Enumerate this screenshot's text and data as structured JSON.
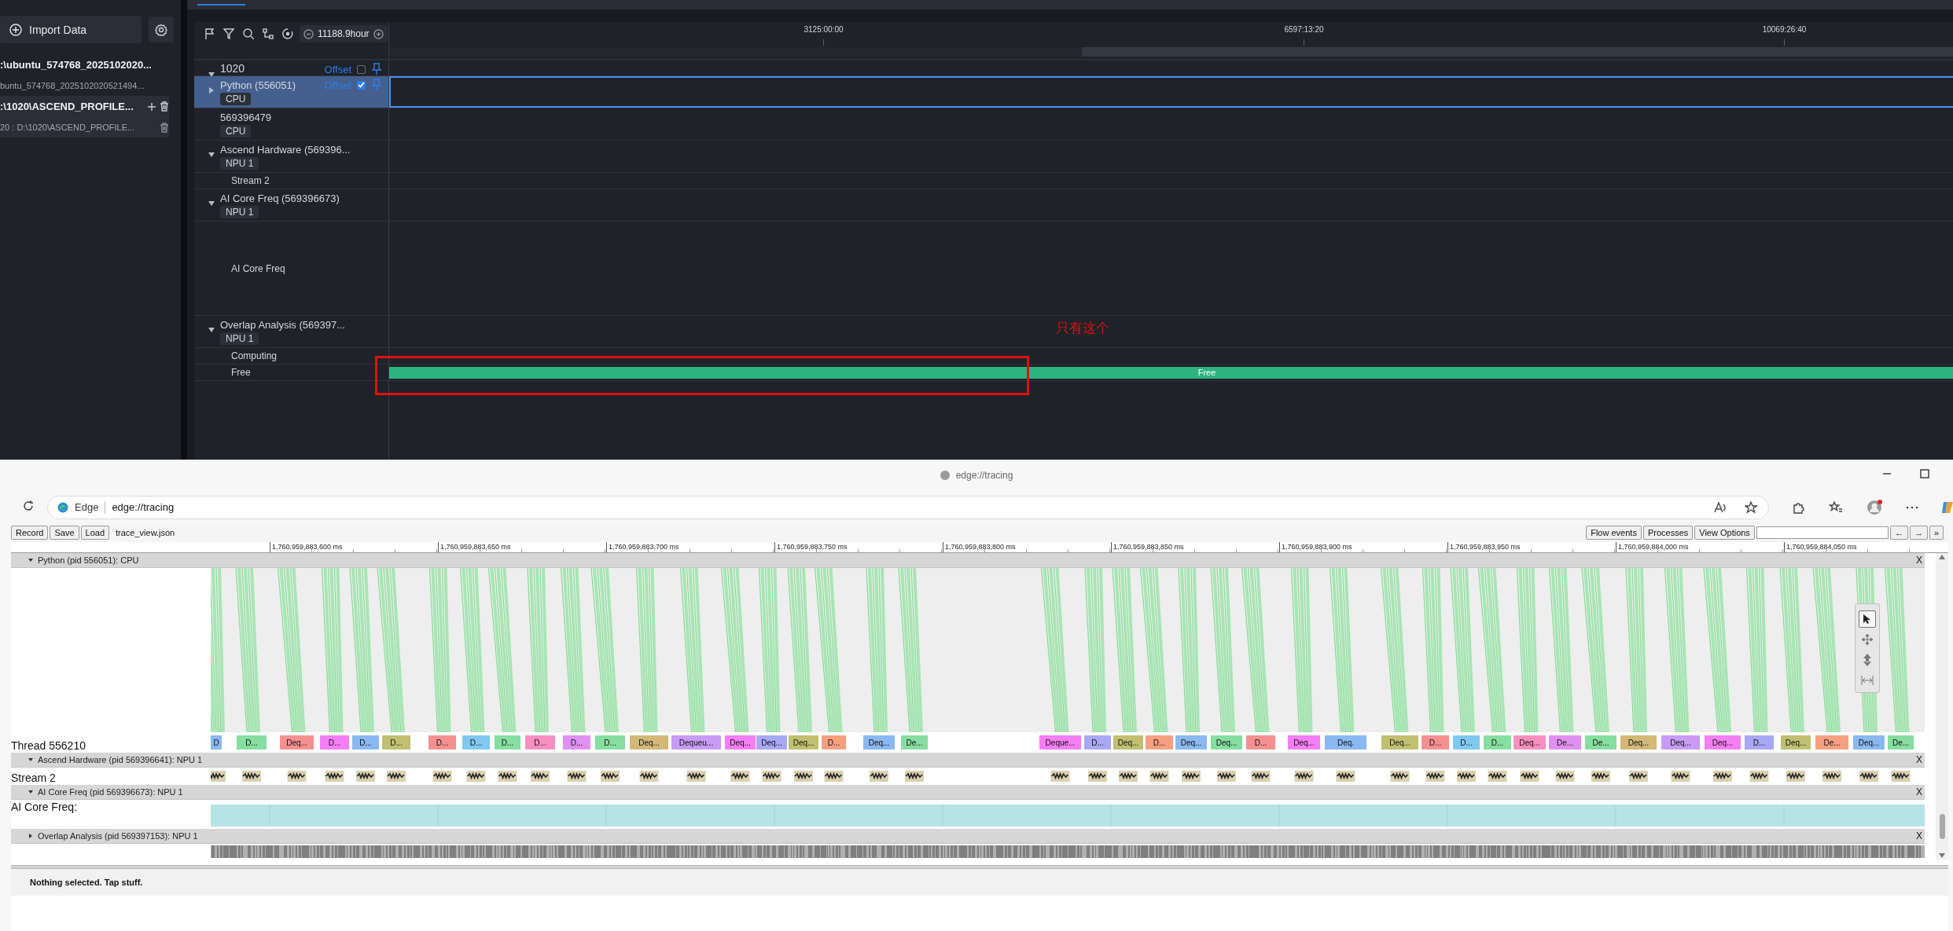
{
  "insight": {
    "sidebar": {
      "import_button": "Import Data",
      "projects": [
        {
          "label": ":\\ubuntu_574768_2025102020...",
          "selected": false,
          "children": [
            {
              "label": "buntu_574768_2025102020521494..."
            }
          ]
        },
        {
          "label": ":\\1020\\ASCEND_PROFILE...",
          "selected": true,
          "children": [
            {
              "label": "20 : D:\\1020\\ASCEND_PROFILE..."
            }
          ]
        }
      ]
    },
    "toolbar": {
      "zoom_value": "11188.9hour"
    },
    "time_ticks": [
      "3125:00:00",
      "6597:13:20",
      "10069:26:40"
    ],
    "tree": {
      "label": "1020",
      "expanded": true,
      "offset_link": "Offset",
      "offset_checked": false,
      "children": [
        {
          "kind": "process",
          "label": "Python (556051)",
          "tag": "CPU",
          "expanded": false,
          "selected": true,
          "offset_link": "Offset",
          "offset_checked": true
        },
        {
          "kind": "plain",
          "label": "569396479",
          "tag": "CPU",
          "selected": false
        },
        {
          "kind": "process",
          "label": "Ascend Hardware (569396...",
          "tag": "NPU 1",
          "expanded": true,
          "selected": false,
          "children": [
            {
              "kind": "thread",
              "label": "Stream 2"
            }
          ]
        },
        {
          "kind": "process",
          "label": "AI Core Freq (569396673)",
          "tag": "NPU 1",
          "expanded": true,
          "selected": false,
          "children": [
            {
              "kind": "counter",
              "label": "AI Core Freq"
            }
          ]
        },
        {
          "kind": "process",
          "label": "Overlap Analysis (569397...",
          "tag": "NPU 1",
          "expanded": true,
          "selected": false,
          "children": [
            {
              "kind": "thread",
              "label": "Computing"
            },
            {
              "kind": "thread",
              "label": "Free",
              "bar": "Free"
            }
          ]
        }
      ]
    },
    "annotation": "只有这个"
  },
  "browser": {
    "page_title": "edge://tracing",
    "site_label": "Edge",
    "url": "edge://tracing",
    "tracing": {
      "left_buttons": [
        "Record",
        "Save",
        "Load"
      ],
      "file_name": "trace_view.json",
      "right_buttons": [
        "Flow events",
        "Processes",
        "View Options"
      ],
      "nav_buttons": [
        "←",
        "→",
        "»"
      ],
      "ruler": [
        "1,760,959,883,600 ms",
        "1,760,959,883,650 ms",
        "1,760,959,883,700 ms",
        "1,760,959,883,750 ms",
        "1,760,959,883,800 ms",
        "1,760,959,883,850 ms",
        "1,760,959,883,900 ms",
        "1,760,959,883,950 ms",
        "1,760,959,884,000 ms",
        "1,760,959,884,050 ms"
      ],
      "processes": [
        {
          "title": "Python (pid 556051): CPU",
          "expanded": true,
          "close": "X",
          "rows": [
            {
              "kind": "flows"
            },
            {
              "kind": "slices",
              "label": "Thread 556210",
              "slices": [
                {
                  "label": "D",
                  "color": "#8ab8f0"
                },
                {
                  "label": "D...",
                  "color": "#86dea0"
                },
                {
                  "label": "Deq...",
                  "color": "#f59090"
                },
                {
                  "label": "D...",
                  "color": "#f47ef4"
                },
                {
                  "label": "D...",
                  "color": "#8ab8f0"
                },
                {
                  "label": "D...",
                  "color": "#c0c070"
                },
                {
                  "label": "D...",
                  "color": "#f59090"
                },
                {
                  "label": "D...",
                  "color": "#80c8f0"
                },
                {
                  "label": "D...",
                  "color": "#86dea0"
                },
                {
                  "label": "D...",
                  "color": "#f790c0"
                },
                {
                  "label": "D...",
                  "color": "#e090f0"
                },
                {
                  "label": "D...",
                  "color": "#86dea0"
                },
                {
                  "label": "Deq...",
                  "color": "#d4b878"
                },
                {
                  "label": "Dequeu...",
                  "color": "#c89cf5"
                },
                {
                  "label": "Deq...",
                  "color": "#f47ef4"
                },
                {
                  "label": "Deq...",
                  "color": "#a8a8f5"
                },
                {
                  "label": "Deq...",
                  "color": "#c0c070"
                },
                {
                  "label": "D...",
                  "color": "#f5a080"
                },
                {
                  "label": "Deq...",
                  "color": "#8ab8f0"
                },
                {
                  "label": "De...",
                  "color": "#86dea0"
                },
                {
                  "label": "Deque...",
                  "color": "#f47ef4"
                },
                {
                  "label": "D...",
                  "color": "#a8a8f5"
                },
                {
                  "label": "Deq...",
                  "color": "#c0c070"
                },
                {
                  "label": "D...",
                  "color": "#f5a080"
                },
                {
                  "label": "Deq...",
                  "color": "#8ab8f0"
                },
                {
                  "label": "Deq...",
                  "color": "#86dea0"
                },
                {
                  "label": "D...",
                  "color": "#f59090"
                },
                {
                  "label": "Deq...",
                  "color": "#f47ef4"
                },
                {
                  "label": "Deq.",
                  "color": "#8ab8f0"
                },
                {
                  "label": "Deq...",
                  "color": "#c0c070"
                },
                {
                  "label": "D...",
                  "color": "#f59090"
                },
                {
                  "label": "D...",
                  "color": "#80c8f0"
                },
                {
                  "label": "D...",
                  "color": "#86dea0"
                },
                {
                  "label": "Deq...",
                  "color": "#f790c0"
                },
                {
                  "label": "De...",
                  "color": "#e090f0"
                },
                {
                  "label": "De...",
                  "color": "#86dea0"
                },
                {
                  "label": "Deq...",
                  "color": "#d4b878"
                },
                {
                  "label": "Deq...",
                  "color": "#c89cf5"
                },
                {
                  "label": "Deq...",
                  "color": "#f47ef4"
                },
                {
                  "label": "D...",
                  "color": "#a8a8f5"
                },
                {
                  "label": "Deq...",
                  "color": "#c0c070"
                },
                {
                  "label": "De...",
                  "color": "#f5a080"
                },
                {
                  "label": "Deq...",
                  "color": "#8ab8f0"
                },
                {
                  "label": "De...",
                  "color": "#86dea0"
                }
              ]
            }
          ]
        },
        {
          "title": "Ascend Hardware (pid 569396641): NPU 1",
          "expanded": true,
          "close": "X",
          "rows": [
            {
              "kind": "kernels",
              "label": "Stream 2"
            }
          ]
        },
        {
          "title": "AI Core Freq (pid 569396673): NPU 1",
          "expanded": true,
          "close": "X",
          "rows": [
            {
              "kind": "counter",
              "label": "AI Core Freq:"
            }
          ]
        },
        {
          "title": "Overlap Analysis (pid 569397153): NPU 1",
          "expanded": false,
          "close": "X",
          "rows": [
            {
              "kind": "overlap"
            }
          ]
        }
      ],
      "mouse_modes": [
        {
          "selected": true
        },
        {
          "selected": false
        },
        {
          "selected": false
        },
        {
          "selected": false
        }
      ],
      "status": "Nothing selected. Tap stuff."
    }
  }
}
